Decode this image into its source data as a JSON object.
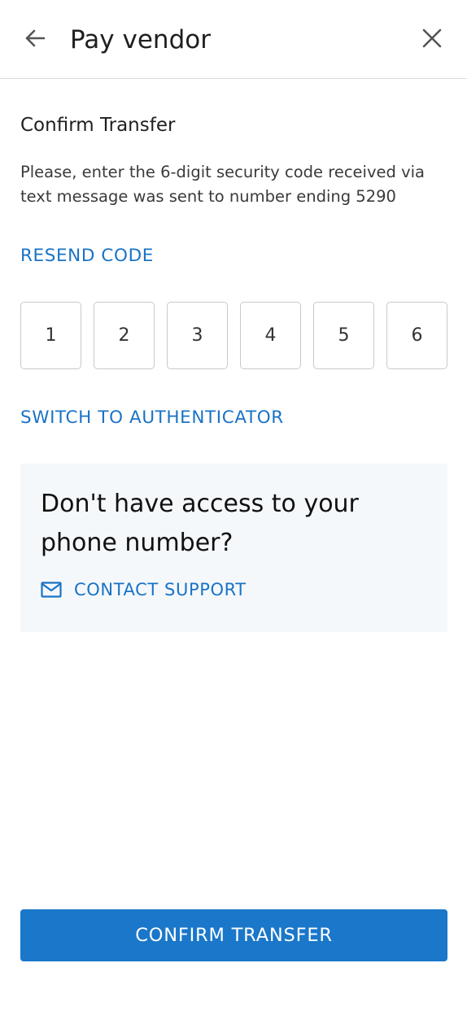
{
  "header": {
    "title": "Pay vendor",
    "back_icon": "arrow-left-icon",
    "close_icon": "close-icon"
  },
  "confirm": {
    "title": "Confirm Transfer",
    "instructions": "Please, enter the 6-digit security code received via text message was sent to number ending 5290",
    "resend_label": "RESEND CODE",
    "code_digits": [
      "1",
      "2",
      "3",
      "4",
      "5",
      "6"
    ],
    "switch_label": "SWITCH TO AUTHENTICATOR"
  },
  "support": {
    "heading": "Don't have access to your phone number?",
    "contact_label": "CONTACT SUPPORT",
    "contact_icon": "mail-icon"
  },
  "footer": {
    "confirm_label": "CONFIRM TRANSFER"
  },
  "colors": {
    "accent": "#1a73c6",
    "button_bg": "#1a77c9",
    "card_bg": "#f5f8fb",
    "text": "#1f1f1f"
  }
}
